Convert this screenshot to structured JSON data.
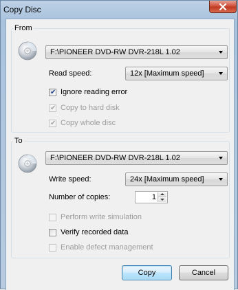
{
  "window": {
    "title": "Copy Disc"
  },
  "from": {
    "group_label": "From",
    "drive_value": "F:\\PIONEER DVD-RW  DVR-218L 1.02",
    "read_speed_label": "Read speed:",
    "read_speed_value": "12x [Maximum speed]",
    "ignore_errors_label": "Ignore reading error",
    "ignore_errors_checked": true,
    "copy_to_hard_disk_label": "Copy to hard disk",
    "copy_to_hard_disk_checked": true,
    "copy_whole_disc_label": "Copy whole disc",
    "copy_whole_disc_checked": true
  },
  "to": {
    "group_label": "To",
    "drive_value": "F:\\PIONEER DVD-RW  DVR-218L 1.02",
    "write_speed_label": "Write speed:",
    "write_speed_value": "24x [Maximum speed]",
    "copies_label": "Number of copies:",
    "copies_value": "1",
    "simulation_label": "Perform write simulation",
    "simulation_checked": false,
    "verify_label": "Verify recorded data",
    "verify_checked": false,
    "defect_label": "Enable defect management",
    "defect_checked": false
  },
  "buttons": {
    "copy": "Copy",
    "cancel": "Cancel"
  },
  "icons": {
    "close": "close-icon",
    "disc": "disc-icon",
    "check": "check-icon",
    "dropdown": "chevron-down-icon"
  },
  "colors": {
    "check_active": "#1f3f8a",
    "disabled_text": "#9c9c9c",
    "close_button": "#c03a22",
    "primary_border": "#3c7fb1"
  }
}
